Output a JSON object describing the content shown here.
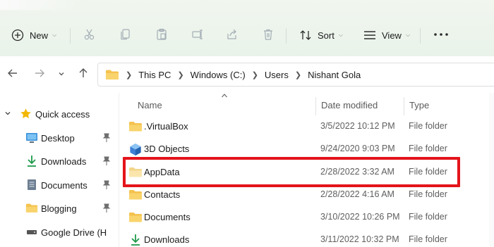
{
  "toolbar": {
    "new_label": "New",
    "sort_label": "Sort",
    "view_label": "View",
    "icons": [
      "plus-circle-icon",
      "cut-icon",
      "copy-icon",
      "paste-icon",
      "rename-icon",
      "share-icon",
      "delete-icon",
      "sort-icon",
      "view-icon",
      "more-icon"
    ]
  },
  "address": {
    "crumbs": [
      "This PC",
      "Windows (C:)",
      "Users",
      "Nishant Gola"
    ]
  },
  "nav": {
    "items": [
      {
        "label": "Quick access",
        "icon": "star-icon"
      },
      {
        "label": "Desktop",
        "icon": "desktop-icon"
      },
      {
        "label": "Downloads",
        "icon": "download-icon"
      },
      {
        "label": "Documents",
        "icon": "document-icon"
      },
      {
        "label": "Blogging",
        "icon": "folder-icon"
      },
      {
        "label": "Google Drive (H",
        "icon": "drive-icon"
      }
    ]
  },
  "columns": {
    "name": "Name",
    "date": "Date modified",
    "type": "Type"
  },
  "files": [
    {
      "name": ".VirtualBox",
      "date": "3/5/2022 10:12 PM",
      "type": "File folder",
      "icon": "folder-icon"
    },
    {
      "name": "3D Objects",
      "date": "9/24/2020 9:03 PM",
      "type": "File folder",
      "icon": "3d-objects-icon"
    },
    {
      "name": "AppData",
      "date": "2/28/2022 3:32 AM",
      "type": "File folder",
      "icon": "folder-icon",
      "highlighted": true
    },
    {
      "name": "Contacts",
      "date": "2/28/2022 4:16 AM",
      "type": "File folder",
      "icon": "folder-icon"
    },
    {
      "name": "Documents",
      "date": "3/10/2022 10:26 PM",
      "type": "File folder",
      "icon": "folder-icon"
    },
    {
      "name": "Downloads",
      "date": "3/11/2022 10:32 PM",
      "type": "File folder",
      "icon": "download-icon"
    }
  ],
  "colors": {
    "toolbar_bg": "#e9f3ea",
    "folder_yellow": "#f4c24f",
    "highlight_red": "#e4141b",
    "download_green": "#1f9a4b"
  }
}
